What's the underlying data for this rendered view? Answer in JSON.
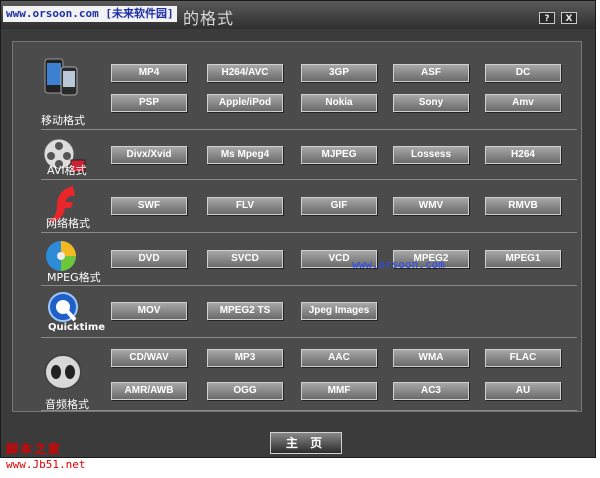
{
  "title_bar": {
    "site_label": "www.orsoon.com",
    "site_label_cn": "[未来软件园]",
    "title": "的格式",
    "help_label": "?",
    "close_label": "X"
  },
  "categories": [
    {
      "label": "移动格式",
      "icon": "mobile-phone-icon",
      "buttons": [
        "MP4",
        "H264/AVC",
        "3GP",
        "ASF",
        "DC",
        "PSP",
        "Apple/iPod",
        "Nokia",
        "Sony",
        "Amv"
      ]
    },
    {
      "label": "AVI格式",
      "icon": "film-reel-icon",
      "buttons": [
        "Divx/Xvid",
        "Ms Mpeg4",
        "MJPEG",
        "Lossess",
        "H264"
      ]
    },
    {
      "label": "网络格式",
      "icon": "flash-icon",
      "buttons": [
        "SWF",
        "FLV",
        "GIF",
        "WMV",
        "RMVB"
      ]
    },
    {
      "label": "MPEG格式",
      "icon": "disc-icon",
      "buttons": [
        "DVD",
        "SVCD",
        "VCD",
        "MPEG2",
        "MPEG1"
      ]
    },
    {
      "label": "Quicktime",
      "icon": "quicktime-icon",
      "buttons": [
        "MOV",
        "MPEG2 TS",
        "Jpeg Images"
      ]
    },
    {
      "label": "音频格式",
      "icon": "audio-icon",
      "buttons": [
        "CD/WAV",
        "MP3",
        "AAC",
        "WMA",
        "FLAC",
        "AMR/AWB",
        "OGG",
        "MMF",
        "AC3",
        "AU"
      ]
    }
  ],
  "home_button": "主 页",
  "watermark": "www.orsoon.com",
  "footer_watermark_cn": "脚本之家",
  "footer_watermark_url": "www.Jb51.net"
}
